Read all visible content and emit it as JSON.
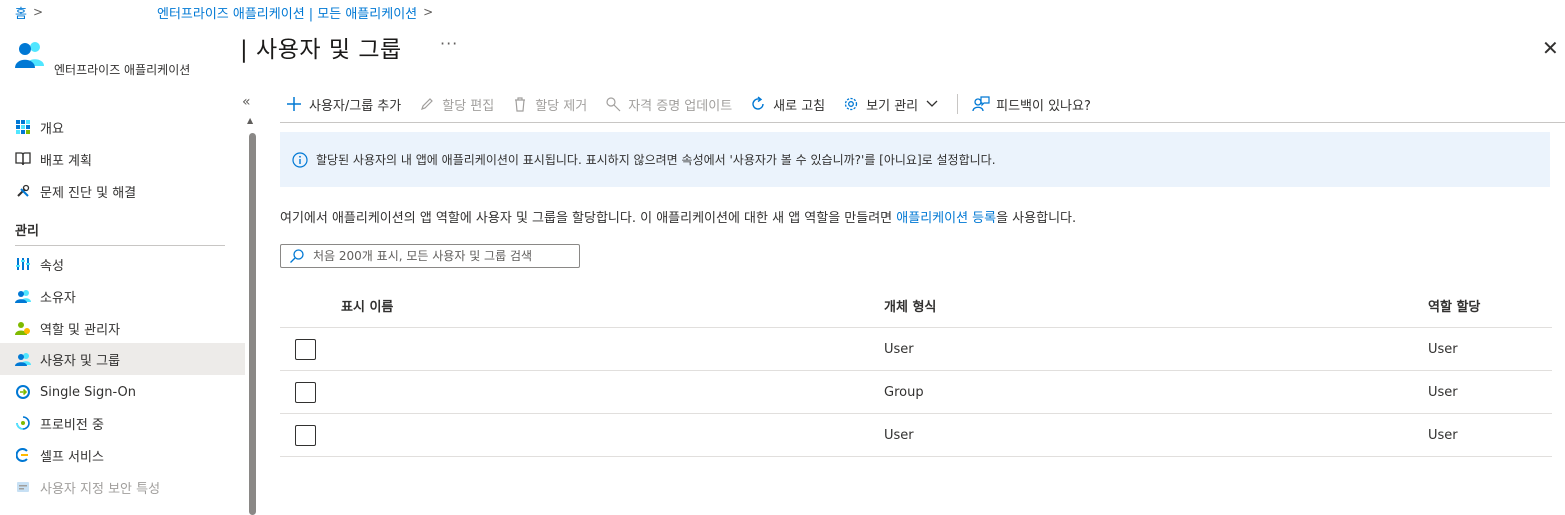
{
  "breadcrumb": {
    "home": "홈",
    "item": "엔터프라이즈 애플리케이션 | 모든 애플리케이션"
  },
  "header": {
    "app_subtitle": "엔터프라이즈 애플리케이션",
    "title": "| 사용자 및 그룹",
    "more": "···",
    "close": "✕"
  },
  "sidebar": {
    "collapse": "«",
    "items": [
      {
        "label": "개요",
        "icon": "grid-icon"
      },
      {
        "label": "배포 계획",
        "icon": "book-icon"
      },
      {
        "label": "문제 진단 및 해결",
        "icon": "wrench-icon"
      }
    ],
    "section_title": "관리",
    "manage_items": [
      {
        "label": "속성",
        "icon": "properties-icon"
      },
      {
        "label": "소유자",
        "icon": "owners-icon"
      },
      {
        "label": "역할 및 관리자",
        "icon": "roles-icon"
      },
      {
        "label": "사용자 및 그룹",
        "icon": "users-groups-icon",
        "active": true
      },
      {
        "label": "Single Sign-On",
        "icon": "sso-icon"
      },
      {
        "label": "프로비전 중",
        "icon": "provisioning-icon"
      },
      {
        "label": "셀프 서비스",
        "icon": "self-service-icon"
      },
      {
        "label": "사용자 지정 보안 특성",
        "icon": "security-attributes-icon",
        "disabled": true
      }
    ]
  },
  "toolbar": {
    "add": "사용자/그룹 추가",
    "edit": "할당 편집",
    "remove": "할당 제거",
    "update_credentials": "자격 증명 업데이트",
    "refresh": "새로 고침",
    "manage_view": "보기 관리",
    "feedback": "피드백이 있나요?"
  },
  "info_banner": "할당된 사용자의 내 앱에 애플리케이션이 표시됩니다. 표시하지 않으려면 속성에서 '사용자가 볼 수 있습니까?'를 [아니요]로 설정합니다.",
  "description": {
    "before": "여기에서 애플리케이션의 앱 역할에 사용자 및 그룹을 할당합니다. 이 애플리케이션에 대한 새 앱 역할을 만들려면 ",
    "link": "애플리케이션 등록",
    "after": "을 사용합니다."
  },
  "search": {
    "placeholder": "처음 200개 표시, 모든 사용자 및 그룹 검색",
    "value": ""
  },
  "table": {
    "columns": [
      "표시 이름",
      "개체 형식",
      "역할 할당"
    ],
    "rows": [
      {
        "display_name": "",
        "object_type": "User",
        "role": "User"
      },
      {
        "display_name": "",
        "object_type": "Group",
        "role": "User"
      },
      {
        "display_name": "",
        "object_type": "User",
        "role": "User"
      }
    ]
  },
  "colors": {
    "accent": "#0078d4",
    "banner_bg": "#ebf3fc",
    "active_nav_bg": "#edebe9"
  }
}
